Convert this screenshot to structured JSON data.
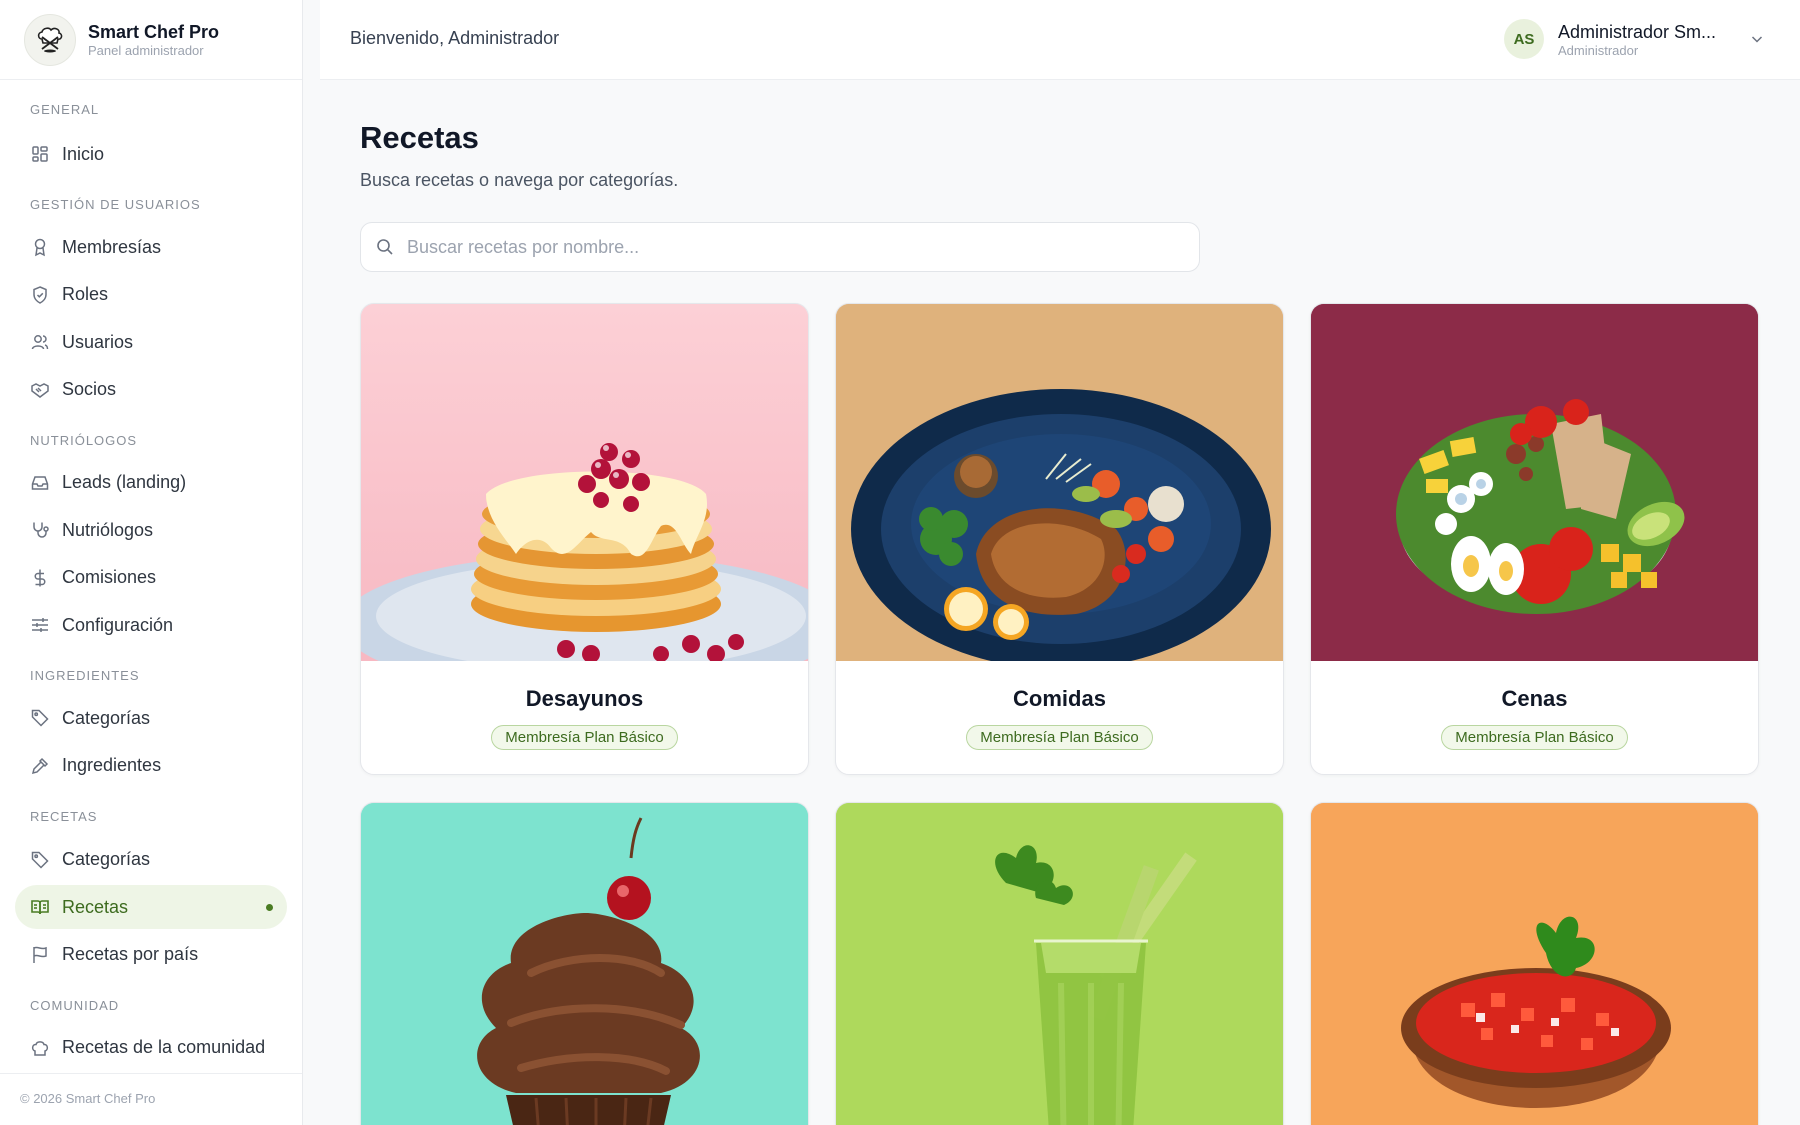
{
  "brand": {
    "title": "Smart Chef Pro",
    "subtitle": "Panel administrador"
  },
  "sidebar": {
    "sections": [
      {
        "title": "GENERAL",
        "items": [
          {
            "label": "Inicio",
            "icon": "grid-icon"
          }
        ]
      },
      {
        "title": "GESTIÓN DE USUARIOS",
        "items": [
          {
            "label": "Membresías",
            "icon": "award-icon"
          },
          {
            "label": "Roles",
            "icon": "shield-icon"
          },
          {
            "label": "Usuarios",
            "icon": "users-icon"
          },
          {
            "label": "Socios",
            "icon": "handshake-icon"
          }
        ]
      },
      {
        "title": "NUTRIÓLOGOS",
        "items": [
          {
            "label": "Leads (landing)",
            "icon": "inbox-icon"
          },
          {
            "label": "Nutriólogos",
            "icon": "stethoscope-icon"
          },
          {
            "label": "Comisiones",
            "icon": "dollar-icon"
          },
          {
            "label": "Configuración",
            "icon": "sliders-icon"
          }
        ]
      },
      {
        "title": "INGREDIENTES",
        "items": [
          {
            "label": "Categorías",
            "icon": "tag-icon"
          },
          {
            "label": "Ingredientes",
            "icon": "pipette-icon"
          }
        ]
      },
      {
        "title": "RECETAS",
        "items": [
          {
            "label": "Categorías",
            "icon": "tag-icon"
          },
          {
            "label": "Recetas",
            "icon": "book-icon",
            "active": true
          },
          {
            "label": "Recetas por país",
            "icon": "flag-icon"
          }
        ]
      },
      {
        "title": "COMUNIDAD",
        "items": [
          {
            "label": "Recetas de la comunidad",
            "icon": "chef-hat-icon"
          }
        ]
      }
    ],
    "footer": "© 2026 Smart Chef Pro"
  },
  "topbar": {
    "welcome": "Bienvenido, Administrador",
    "user_initials": "AS",
    "user_name": "Administrador Sm...",
    "user_role": "Administrador"
  },
  "main": {
    "title": "Recetas",
    "subtitle": "Busca recetas o navega por categorías.",
    "search_placeholder": "Buscar recetas por nombre...",
    "cards": [
      {
        "title": "Desayunos",
        "badge": "Membresía Plan Básico",
        "bg": "#fbc8d0",
        "image": "pancakes"
      },
      {
        "title": "Comidas",
        "badge": "Membresía Plan Básico",
        "bg": "#dfb27c",
        "image": "roast-chicken-plate"
      },
      {
        "title": "Cenas",
        "badge": "Membresía Plan Básico",
        "bg": "#8c2b48",
        "image": "cobb-salad"
      },
      {
        "title": "",
        "badge": "",
        "bg": "#7de3cf",
        "image": "chocolate-cupcake"
      },
      {
        "title": "",
        "badge": "",
        "bg": "#aed95c",
        "image": "green-smoothie"
      },
      {
        "title": "",
        "badge": "",
        "bg": "#f7a55a",
        "image": "pico-de-gallo"
      }
    ]
  },
  "colors": {
    "accent": "#4a7c23",
    "active_bg": "#eef5e6",
    "badge_border": "#b9d6a0"
  }
}
